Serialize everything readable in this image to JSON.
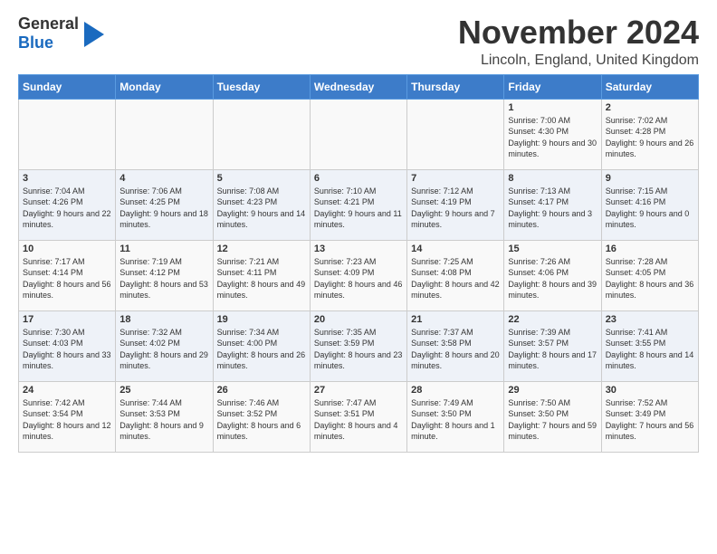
{
  "logo": {
    "line1": "General",
    "line2": "Blue"
  },
  "title": "November 2024",
  "subtitle": "Lincoln, England, United Kingdom",
  "days_of_week": [
    "Sunday",
    "Monday",
    "Tuesday",
    "Wednesday",
    "Thursday",
    "Friday",
    "Saturday"
  ],
  "weeks": [
    [
      {
        "day": "",
        "info": ""
      },
      {
        "day": "",
        "info": ""
      },
      {
        "day": "",
        "info": ""
      },
      {
        "day": "",
        "info": ""
      },
      {
        "day": "",
        "info": ""
      },
      {
        "day": "1",
        "info": "Sunrise: 7:00 AM\nSunset: 4:30 PM\nDaylight: 9 hours and 30 minutes."
      },
      {
        "day": "2",
        "info": "Sunrise: 7:02 AM\nSunset: 4:28 PM\nDaylight: 9 hours and 26 minutes."
      }
    ],
    [
      {
        "day": "3",
        "info": "Sunrise: 7:04 AM\nSunset: 4:26 PM\nDaylight: 9 hours and 22 minutes."
      },
      {
        "day": "4",
        "info": "Sunrise: 7:06 AM\nSunset: 4:25 PM\nDaylight: 9 hours and 18 minutes."
      },
      {
        "day": "5",
        "info": "Sunrise: 7:08 AM\nSunset: 4:23 PM\nDaylight: 9 hours and 14 minutes."
      },
      {
        "day": "6",
        "info": "Sunrise: 7:10 AM\nSunset: 4:21 PM\nDaylight: 9 hours and 11 minutes."
      },
      {
        "day": "7",
        "info": "Sunrise: 7:12 AM\nSunset: 4:19 PM\nDaylight: 9 hours and 7 minutes."
      },
      {
        "day": "8",
        "info": "Sunrise: 7:13 AM\nSunset: 4:17 PM\nDaylight: 9 hours and 3 minutes."
      },
      {
        "day": "9",
        "info": "Sunrise: 7:15 AM\nSunset: 4:16 PM\nDaylight: 9 hours and 0 minutes."
      }
    ],
    [
      {
        "day": "10",
        "info": "Sunrise: 7:17 AM\nSunset: 4:14 PM\nDaylight: 8 hours and 56 minutes."
      },
      {
        "day": "11",
        "info": "Sunrise: 7:19 AM\nSunset: 4:12 PM\nDaylight: 8 hours and 53 minutes."
      },
      {
        "day": "12",
        "info": "Sunrise: 7:21 AM\nSunset: 4:11 PM\nDaylight: 8 hours and 49 minutes."
      },
      {
        "day": "13",
        "info": "Sunrise: 7:23 AM\nSunset: 4:09 PM\nDaylight: 8 hours and 46 minutes."
      },
      {
        "day": "14",
        "info": "Sunrise: 7:25 AM\nSunset: 4:08 PM\nDaylight: 8 hours and 42 minutes."
      },
      {
        "day": "15",
        "info": "Sunrise: 7:26 AM\nSunset: 4:06 PM\nDaylight: 8 hours and 39 minutes."
      },
      {
        "day": "16",
        "info": "Sunrise: 7:28 AM\nSunset: 4:05 PM\nDaylight: 8 hours and 36 minutes."
      }
    ],
    [
      {
        "day": "17",
        "info": "Sunrise: 7:30 AM\nSunset: 4:03 PM\nDaylight: 8 hours and 33 minutes."
      },
      {
        "day": "18",
        "info": "Sunrise: 7:32 AM\nSunset: 4:02 PM\nDaylight: 8 hours and 29 minutes."
      },
      {
        "day": "19",
        "info": "Sunrise: 7:34 AM\nSunset: 4:00 PM\nDaylight: 8 hours and 26 minutes."
      },
      {
        "day": "20",
        "info": "Sunrise: 7:35 AM\nSunset: 3:59 PM\nDaylight: 8 hours and 23 minutes."
      },
      {
        "day": "21",
        "info": "Sunrise: 7:37 AM\nSunset: 3:58 PM\nDaylight: 8 hours and 20 minutes."
      },
      {
        "day": "22",
        "info": "Sunrise: 7:39 AM\nSunset: 3:57 PM\nDaylight: 8 hours and 17 minutes."
      },
      {
        "day": "23",
        "info": "Sunrise: 7:41 AM\nSunset: 3:55 PM\nDaylight: 8 hours and 14 minutes."
      }
    ],
    [
      {
        "day": "24",
        "info": "Sunrise: 7:42 AM\nSunset: 3:54 PM\nDaylight: 8 hours and 12 minutes."
      },
      {
        "day": "25",
        "info": "Sunrise: 7:44 AM\nSunset: 3:53 PM\nDaylight: 8 hours and 9 minutes."
      },
      {
        "day": "26",
        "info": "Sunrise: 7:46 AM\nSunset: 3:52 PM\nDaylight: 8 hours and 6 minutes."
      },
      {
        "day": "27",
        "info": "Sunrise: 7:47 AM\nSunset: 3:51 PM\nDaylight: 8 hours and 4 minutes."
      },
      {
        "day": "28",
        "info": "Sunrise: 7:49 AM\nSunset: 3:50 PM\nDaylight: 8 hours and 1 minute."
      },
      {
        "day": "29",
        "info": "Sunrise: 7:50 AM\nSunset: 3:50 PM\nDaylight: 7 hours and 59 minutes."
      },
      {
        "day": "30",
        "info": "Sunrise: 7:52 AM\nSunset: 3:49 PM\nDaylight: 7 hours and 56 minutes."
      }
    ]
  ]
}
